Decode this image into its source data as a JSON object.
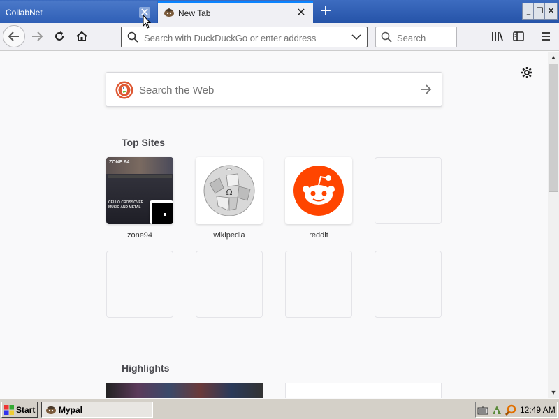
{
  "tabs": [
    {
      "title": "CollabNet",
      "active": true
    },
    {
      "title": "New Tab",
      "active": false
    }
  ],
  "toolbar": {
    "url_placeholder": "Search with DuckDuckGo or enter address",
    "search_placeholder": "Search"
  },
  "newtab": {
    "websearch_placeholder": "Search the Web",
    "top_sites_title": "Top Sites",
    "highlights_title": "Highlights",
    "top_sites": [
      {
        "label": "zone94",
        "thumb_text": "CELLO CROSSOVER MUSIC AND METAL",
        "logo": "ZONE 94"
      },
      {
        "label": "wikipedia"
      },
      {
        "label": "reddit"
      },
      {
        "label": ""
      },
      {
        "label": ""
      },
      {
        "label": ""
      },
      {
        "label": ""
      },
      {
        "label": ""
      }
    ]
  },
  "taskbar": {
    "start_label": "Start",
    "task_label": "Mypal",
    "clock": "12:49 AM"
  },
  "colors": {
    "tab_accent": "#0a84ff",
    "reddit": "#ff4500",
    "ddg": "#de5833",
    "titlebar": "#2553a8"
  }
}
